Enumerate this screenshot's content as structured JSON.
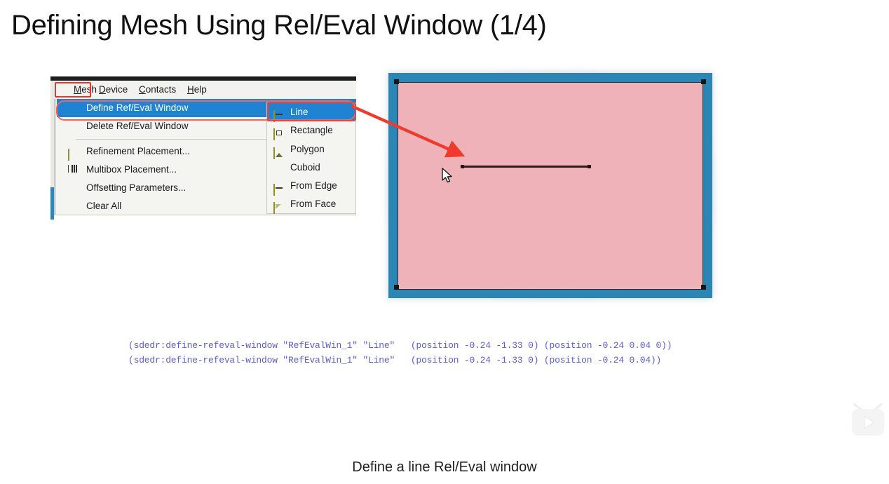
{
  "slide": {
    "title": "Defining Mesh Using Rel/Eval Window (1/4)",
    "caption": "Define a line Rel/Eval window"
  },
  "app": {
    "menubar": {
      "items": [
        {
          "label": "Mesh",
          "name": "menubar-item-mesh",
          "highlighted": true
        },
        {
          "label": "Device",
          "name": "menubar-item-device",
          "highlighted": false
        },
        {
          "label": "Contacts",
          "name": "menubar-item-contacts",
          "highlighted": false
        },
        {
          "label": "Help",
          "name": "menubar-item-help",
          "highlighted": false
        }
      ]
    },
    "mesh_menu": {
      "items": [
        {
          "label": "Define Ref/Eval Window",
          "selected": true,
          "submenu": true,
          "icon": "none"
        },
        {
          "label": "Delete Ref/Eval Window",
          "selected": false,
          "submenu": false,
          "icon": "none"
        },
        {
          "label": "Refinement Placement...",
          "selected": false,
          "submenu": false,
          "icon": "grid-icon"
        },
        {
          "label": "Multibox Placement...",
          "selected": false,
          "submenu": false,
          "icon": "bars-icon"
        },
        {
          "label": "Offsetting Parameters...",
          "selected": false,
          "submenu": false,
          "icon": "none"
        },
        {
          "label": "Clear All",
          "selected": false,
          "submenu": true,
          "icon": "none"
        }
      ]
    },
    "define_submenu": {
      "items": [
        {
          "label": "Line",
          "selected": true,
          "icon": "line-icon"
        },
        {
          "label": "Rectangle",
          "selected": false,
          "icon": "rectangle-icon"
        },
        {
          "label": "Polygon",
          "selected": false,
          "icon": "polygon-icon"
        },
        {
          "label": "Cuboid",
          "selected": false,
          "icon": "none"
        },
        {
          "label": "From Edge",
          "selected": false,
          "icon": "line-icon"
        },
        {
          "label": "From Face",
          "selected": false,
          "icon": "face-icon"
        }
      ]
    }
  },
  "viewport": {
    "background_color": "#2b86b6",
    "region_color": "#eeb2b8",
    "outline_color": "#2b2b2b",
    "handle_color": "#161616",
    "line_color": "#2e1b1b",
    "cursor": "mouse-pointer"
  },
  "annotation": {
    "arrow_color": "#ee3b2e",
    "highlight_color": "#ec443a"
  },
  "code": {
    "color": "#5c5cd6",
    "lines": [
      "(sdedr:define-refeval-window \"RefEvalWin_1\" \"Line\"   (position -0.24 -1.33 0) (position -0.24 0.04 0))",
      "(sdedr:define-refeval-window \"RefEvalWin_1\" \"Line\"   (position -0.24 -1.33 0) (position -0.24 0.04))"
    ]
  },
  "watermark": {
    "icon": "tv-play-icon"
  }
}
